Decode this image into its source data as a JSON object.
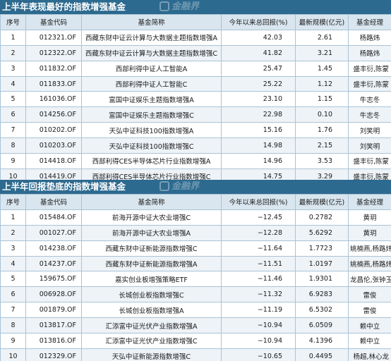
{
  "table1": {
    "title": "上半年表现最好的指数增强基金",
    "watermark": "金融界",
    "headers": [
      "序号",
      "基金代码",
      "基金简称",
      "今年以来总回报(%)",
      "最新规模(亿元)",
      "基金经理"
    ],
    "rows": [
      {
        "idx": "1",
        "code": "012321.OF",
        "name": "西藏东财中证云计算与大数据主题指数增强A",
        "ret": "42.03",
        "size": "2.61",
        "mgr": "杨路炜"
      },
      {
        "idx": "2",
        "code": "012322.OF",
        "name": "西藏东财中证云计算与大数据主题指数增强C",
        "ret": "41.82",
        "size": "3.21",
        "mgr": "杨路炜"
      },
      {
        "idx": "3",
        "code": "011832.OF",
        "name": "西部利得中证人工智能A",
        "ret": "25.47",
        "size": "1.45",
        "mgr": "盛丰衍,陈蒙"
      },
      {
        "idx": "4",
        "code": "011833.OF",
        "name": "西部利得中证人工智能C",
        "ret": "25.22",
        "size": "1.12",
        "mgr": "盛丰衍,陈蒙"
      },
      {
        "idx": "5",
        "code": "161036.OF",
        "name": "富国中证娱乐主题指数增强A",
        "ret": "23.10",
        "size": "1.15",
        "mgr": "牛志冬"
      },
      {
        "idx": "6",
        "code": "014256.OF",
        "name": "富国中证娱乐主题指数增强C",
        "ret": "22.98",
        "size": "0.10",
        "mgr": "牛志冬"
      },
      {
        "idx": "7",
        "code": "010202.OF",
        "name": "天弘中证科技100指数增强A",
        "ret": "15.16",
        "size": "1.76",
        "mgr": "刘笑明"
      },
      {
        "idx": "8",
        "code": "010203.OF",
        "name": "天弘中证科技100指数增强C",
        "ret": "14.98",
        "size": "2.15",
        "mgr": "刘笑明"
      },
      {
        "idx": "9",
        "code": "014418.OF",
        "name": "西部利得CES半导体芯片行业指数增强A",
        "ret": "14.96",
        "size": "3.53",
        "mgr": "盛丰衍,陈蒙"
      },
      {
        "idx": "10",
        "code": "014419.OF",
        "name": "西部利得CES半导体芯片行业指数增强C",
        "ret": "14.75",
        "size": "3.29",
        "mgr": "盛丰衍,陈蒙"
      }
    ]
  },
  "table2": {
    "title": "上半年回报垫底的指数增强基金",
    "watermark": "金融界",
    "headers": [
      "序号",
      "基金代码",
      "基金简称",
      "今年以来总回报(%)",
      "最新规模(亿元)",
      "基金经理"
    ],
    "rows": [
      {
        "idx": "1",
        "code": "015484.OF",
        "name": "前海开源中证大农业增强C",
        "ret": "−12.45",
        "size": "0.2782",
        "mgr": "黄玥"
      },
      {
        "idx": "2",
        "code": "001027.OF",
        "name": "前海开源中证大农业增强A",
        "ret": "−12.28",
        "size": "5.6292",
        "mgr": "黄玥"
      },
      {
        "idx": "3",
        "code": "014238.OF",
        "name": "西藏东财中证新能源指数增强C",
        "ret": "−11.64",
        "size": "1.7723",
        "mgr": "姚楠燕,杨路炜"
      },
      {
        "idx": "4",
        "code": "014237.OF",
        "name": "西藏东财中证新能源指数增强A",
        "ret": "−11.51",
        "size": "1.0197",
        "mgr": "姚楠燕,杨路炜"
      },
      {
        "idx": "5",
        "code": "159675.OF",
        "name": "嘉实创业板增强策略ETF",
        "ret": "−11.46",
        "size": "1.9301",
        "mgr": "龙昌伦,张钟玉"
      },
      {
        "idx": "6",
        "code": "006928.OF",
        "name": "长城创业板指数增强C",
        "ret": "−11.32",
        "size": "6.9283",
        "mgr": "雷俊"
      },
      {
        "idx": "7",
        "code": "001879.OF",
        "name": "长城创业板指数增强A",
        "ret": "−11.19",
        "size": "6.5302",
        "mgr": "雷俊"
      },
      {
        "idx": "8",
        "code": "013817.OF",
        "name": "汇添富中证光伏产业指数增强A",
        "ret": "−10.94",
        "size": "6.0509",
        "mgr": "赖中立"
      },
      {
        "idx": "9",
        "code": "013816.OF",
        "name": "汇添富中证光伏产业指数增强C",
        "ret": "−10.94",
        "size": "4.1396",
        "mgr": "赖中立"
      },
      {
        "idx": "10",
        "code": "012329.OF",
        "name": "天弘中证新能源指数增强C",
        "ret": "−10.65",
        "size": "0.4495",
        "mgr": "杨超,林心龙"
      }
    ]
  }
}
